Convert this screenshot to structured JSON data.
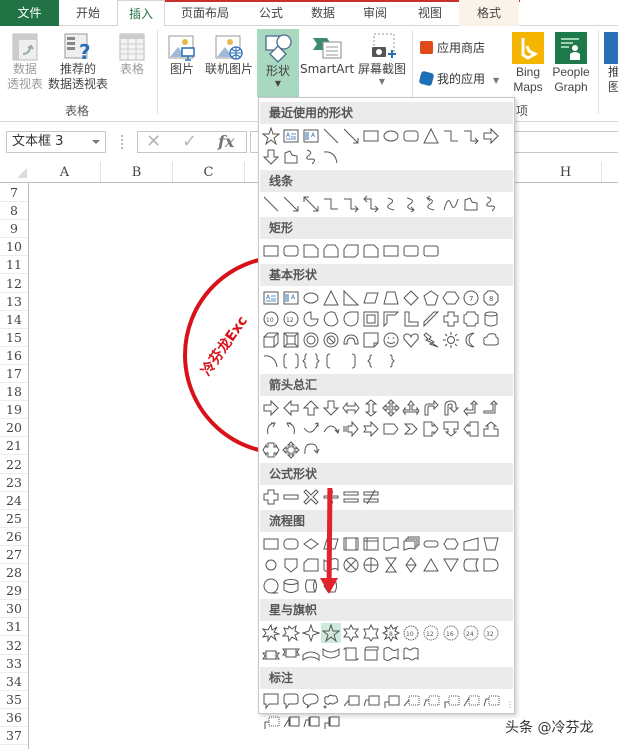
{
  "tabs": [
    {
      "label": "文件",
      "name": "tab-file"
    },
    {
      "label": "开始",
      "name": "tab-home"
    },
    {
      "label": "插入",
      "name": "tab-insert",
      "active": true
    },
    {
      "label": "页面布局",
      "name": "tab-page-layout"
    },
    {
      "label": "公式",
      "name": "tab-formulas"
    },
    {
      "label": "数据",
      "name": "tab-data"
    },
    {
      "label": "审阅",
      "name": "tab-review"
    },
    {
      "label": "视图",
      "name": "tab-view"
    },
    {
      "label": "格式",
      "name": "tab-format"
    }
  ],
  "colors": {
    "file_tab": "#217346",
    "accent_red": "#c8312b",
    "stamp_red": "#d9121a",
    "shapes_highlight": "#a8d8c0",
    "arrow_red": "#e0232a"
  },
  "ribbon": {
    "pivot_table": "数据\n透视表",
    "pivot_table_l1": "数据",
    "pivot_table_l2": "透视表",
    "recommended_pivot_l1": "推荐的",
    "recommended_pivot_l2": "数据透视表",
    "table": "表格",
    "tables_group": "表格",
    "pictures": "图片",
    "online_pictures": "联机图片",
    "shapes": "形状",
    "smartart": "SmartArt",
    "screenshot": "屏幕截图",
    "store": "应用商店",
    "my_apps": "我的应用",
    "bing_maps_l1": "Bing",
    "bing_maps_l2": "Maps",
    "people_graph_l1": "People",
    "people_graph_l2": "Graph",
    "recommended_charts_partial_l1": "推",
    "recommended_charts_partial_l2": "图",
    "addins_group_partial": "项"
  },
  "formula_bar": {
    "name_box": "文本框 3",
    "cancel": "✕",
    "enter": "✓",
    "fx": "fx",
    "value": ""
  },
  "columns": [
    "A",
    "B",
    "C",
    "H"
  ],
  "rows": [
    "7",
    "8",
    "9",
    "10",
    "11",
    "12",
    "13",
    "14",
    "15",
    "16",
    "17",
    "18",
    "19",
    "20",
    "21",
    "22",
    "23",
    "24",
    "25",
    "26",
    "27",
    "28",
    "29",
    "30",
    "31",
    "32",
    "33",
    "34",
    "35",
    "36",
    "37"
  ],
  "stamp_text": "冷芬龙Exc",
  "gallery": {
    "sections": [
      {
        "title": "最近使用的形状",
        "rows": [
          [
            "star5",
            "textbox",
            "vtextbox",
            "line",
            "arrowline",
            "rect",
            "oval",
            "roundrect",
            "triangle",
            "elbow",
            "elbowarrow",
            "rightarrow"
          ],
          [
            "downarrow",
            "freeform",
            "scribble",
            "arc"
          ]
        ]
      },
      {
        "title": "线条",
        "rows": [
          [
            "line",
            "arrowline",
            "dblarrowline",
            "elbow",
            "elbowarrow",
            "elbowdbl",
            "curve",
            "curvearrow",
            "curvedbl",
            "curveshape",
            "freeform",
            "scribble"
          ]
        ]
      },
      {
        "title": "矩形",
        "rows": [
          [
            "rect",
            "roundrect",
            "snip1",
            "snip2",
            "snipdiag",
            "sniprnd",
            "rect",
            "roundrect2",
            "roundrect3"
          ]
        ]
      },
      {
        "title": "基本形状",
        "rows": [
          [
            "textbox",
            "vtextbox",
            "oval",
            "triangle",
            "rtriangle",
            "parallelogram",
            "trapezoid",
            "diamond",
            "pentagon",
            "hexagon",
            "heptagon",
            "octagon"
          ],
          [
            "decagon",
            "dodecagon",
            "pie",
            "chord",
            "teardrop",
            "frame",
            "halfframe",
            "lshape",
            "diagstripe",
            "cross",
            "plaque",
            "can"
          ],
          [
            "cube",
            "bevel",
            "donut",
            "nosymbol",
            "blockarc",
            "foldedcorner",
            "smiley",
            "heart",
            "lightning",
            "sun",
            "moon",
            "cloud"
          ],
          [
            "arc",
            "bracketpair",
            "bracepair",
            "leftbracket",
            "rightbracket",
            "leftbrace",
            "rightbrace"
          ]
        ]
      },
      {
        "title": "箭头总汇",
        "rows": [
          [
            "rightarrow",
            "leftarrow",
            "uparrow",
            "downarrow",
            "lrarrow",
            "udarrow",
            "quadarrow",
            "lrudarrow",
            "bentarrow",
            "uturn",
            "leftuparrow",
            "bentuparrow"
          ],
          [
            "curvedright",
            "curvedleft",
            "curvedup",
            "curveddown",
            "stripedright",
            "notched",
            "pentagonarrow",
            "chevron",
            "rightcallout",
            "downcallout",
            "leftcallout",
            "upcallout"
          ],
          [
            "lrcallout",
            "quadcallout",
            "circulararrow"
          ]
        ]
      },
      {
        "title": "公式形状",
        "rows": [
          [
            "plus",
            "minus",
            "multiply",
            "divide",
            "equal",
            "notequal"
          ]
        ]
      },
      {
        "title": "流程图",
        "rows": [
          [
            "process",
            "altprocess",
            "decision",
            "data",
            "predefined",
            "internal",
            "document",
            "multidoc",
            "terminator",
            "preparation",
            "manualinput",
            "manualop"
          ],
          [
            "connector",
            "offpage",
            "card",
            "punchedtape",
            "summing",
            "or",
            "collate",
            "sort",
            "extract",
            "merge",
            "storeddata",
            "delay"
          ],
          [
            "seqaccess",
            "magdisk",
            "directaccess",
            "display"
          ]
        ]
      },
      {
        "title": "星与旗帜",
        "rows": [
          [
            "explosion1",
            "explosion2",
            "star4",
            "star5",
            "star6",
            "star7",
            "star8",
            "star10",
            "star12",
            "star16",
            "star24",
            "star32"
          ],
          [
            "ribbonup",
            "ribbondown",
            "curvedribbonup",
            "curvedribbondown",
            "vscroll",
            "hscroll",
            "wave",
            "doublewave"
          ]
        ]
      },
      {
        "title": "标注",
        "rows": [
          [
            "rectcallout",
            "roundcallout",
            "ovalcallout",
            "cloudcallout",
            "linecallout1",
            "linecallout2",
            "linecallout3",
            "linecallout1n",
            "linecallout2n",
            "linecallout3n",
            "linecallout1b",
            "linecallout2b"
          ],
          [
            "linecallout3b",
            "linecallout1a",
            "linecallout2a",
            "linecallout3a"
          ]
        ]
      }
    ],
    "selected": "star5 (星与旗帜)"
  },
  "watermark": "头条 @冷芬龙"
}
